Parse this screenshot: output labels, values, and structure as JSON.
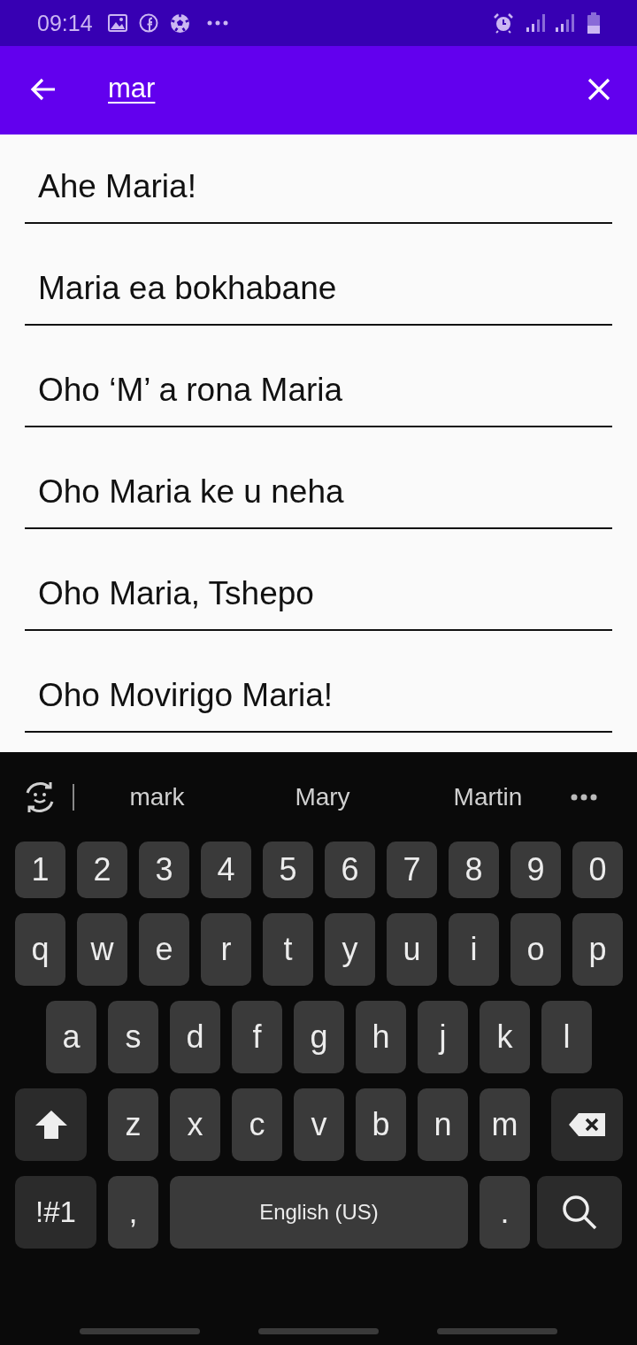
{
  "status_bar": {
    "time": "09:14"
  },
  "search_bar": {
    "query": "mar"
  },
  "results": [
    {
      "title": "Ahe Maria!"
    },
    {
      "title": "Maria ea bokhabane"
    },
    {
      "title": "Oho ‘M’ a rona Maria"
    },
    {
      "title": "Oho Maria ke u neha"
    },
    {
      "title": "Oho Maria, Tshepo"
    },
    {
      "title": "Oho Movirigo Maria!"
    }
  ],
  "keyboard": {
    "suggestions": [
      "mark",
      "Mary",
      "Martin"
    ],
    "number_row": [
      {
        "kind": "char",
        "label": "1"
      },
      {
        "kind": "char",
        "label": "2"
      },
      {
        "kind": "char",
        "label": "3"
      },
      {
        "kind": "char",
        "label": "4"
      },
      {
        "kind": "char",
        "label": "5"
      },
      {
        "kind": "char",
        "label": "6"
      },
      {
        "kind": "char",
        "label": "7"
      },
      {
        "kind": "char",
        "label": "8"
      },
      {
        "kind": "char",
        "label": "9"
      },
      {
        "kind": "char",
        "label": "0"
      }
    ],
    "top_row": [
      {
        "kind": "char",
        "label": "q"
      },
      {
        "kind": "char",
        "label": "w"
      },
      {
        "kind": "char",
        "label": "e"
      },
      {
        "kind": "char",
        "label": "r"
      },
      {
        "kind": "char",
        "label": "t"
      },
      {
        "kind": "char",
        "label": "y"
      },
      {
        "kind": "char",
        "label": "u"
      },
      {
        "kind": "char",
        "label": "i"
      },
      {
        "kind": "char",
        "label": "o"
      },
      {
        "kind": "char",
        "label": "p"
      }
    ],
    "home_row": [
      {
        "kind": "char",
        "label": "a"
      },
      {
        "kind": "char",
        "label": "s"
      },
      {
        "kind": "char",
        "label": "d"
      },
      {
        "kind": "char",
        "label": "f"
      },
      {
        "kind": "char",
        "label": "g"
      },
      {
        "kind": "char",
        "label": "h"
      },
      {
        "kind": "char",
        "label": "j"
      },
      {
        "kind": "char",
        "label": "k"
      },
      {
        "kind": "char",
        "label": "l"
      }
    ],
    "bottom_row": [
      {
        "kind": "shift"
      },
      {
        "kind": "char",
        "label": "z"
      },
      {
        "kind": "char",
        "label": "x"
      },
      {
        "kind": "char",
        "label": "c"
      },
      {
        "kind": "char",
        "label": "v"
      },
      {
        "kind": "char",
        "label": "b"
      },
      {
        "kind": "char",
        "label": "n"
      },
      {
        "kind": "char",
        "label": "m"
      },
      {
        "kind": "backspace"
      }
    ],
    "function_row": [
      {
        "kind": "symbols",
        "label": "!#1"
      },
      {
        "kind": "char",
        "label": ","
      },
      {
        "kind": "space",
        "label": "English (US)"
      },
      {
        "kind": "char",
        "label": "."
      },
      {
        "kind": "search"
      }
    ]
  }
}
